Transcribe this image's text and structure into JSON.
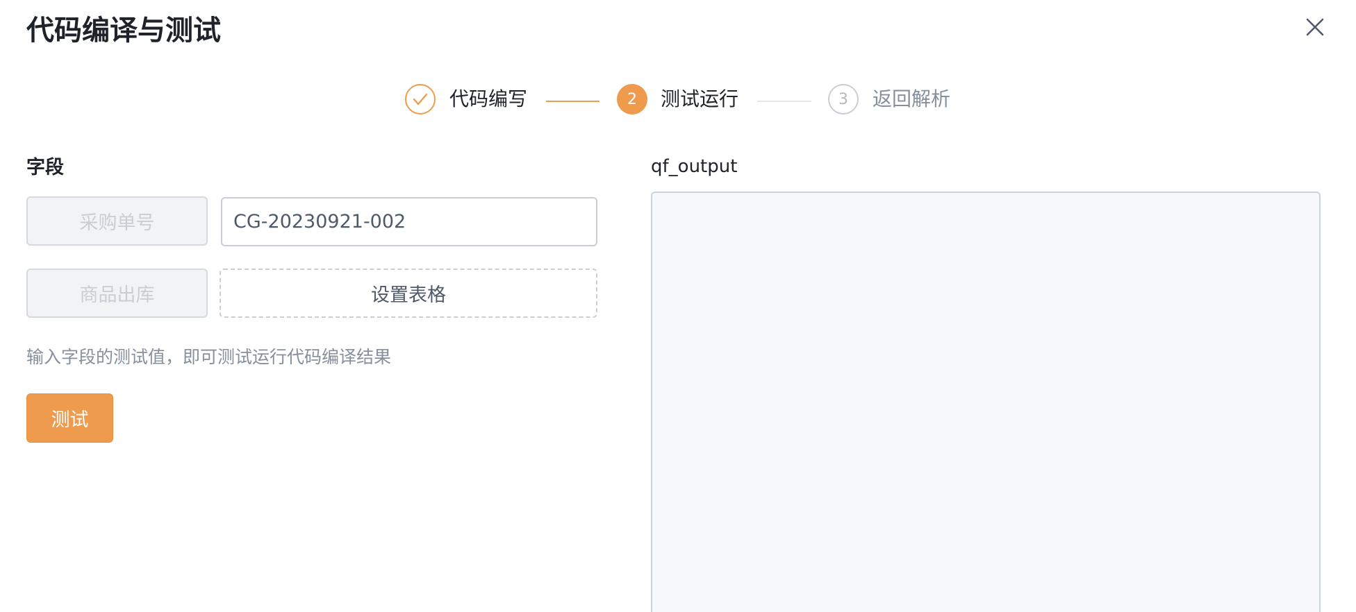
{
  "dialog": {
    "title": "代码编译与测试",
    "close_icon": "close-icon"
  },
  "steps": [
    {
      "label": "代码编写",
      "status": "done",
      "icon": "check-icon"
    },
    {
      "label": "测试运行",
      "status": "active",
      "number": "2"
    },
    {
      "label": "返回解析",
      "status": "wait",
      "number": "3"
    }
  ],
  "fields": {
    "section_label": "字段",
    "rows": [
      {
        "name": "采购单号",
        "value": "CG-20230921-002"
      },
      {
        "name": "商品出库",
        "action_label": "设置表格"
      }
    ],
    "hint": "输入字段的测试值，即可测试运行代码编译结果",
    "test_button": "测试"
  },
  "output": {
    "label": "qf_output",
    "value": ""
  },
  "colors": {
    "accent": "#ee9b4e",
    "text_primary": "#1f2329",
    "text_muted": "#86909c",
    "border": "#c9cdd4"
  }
}
